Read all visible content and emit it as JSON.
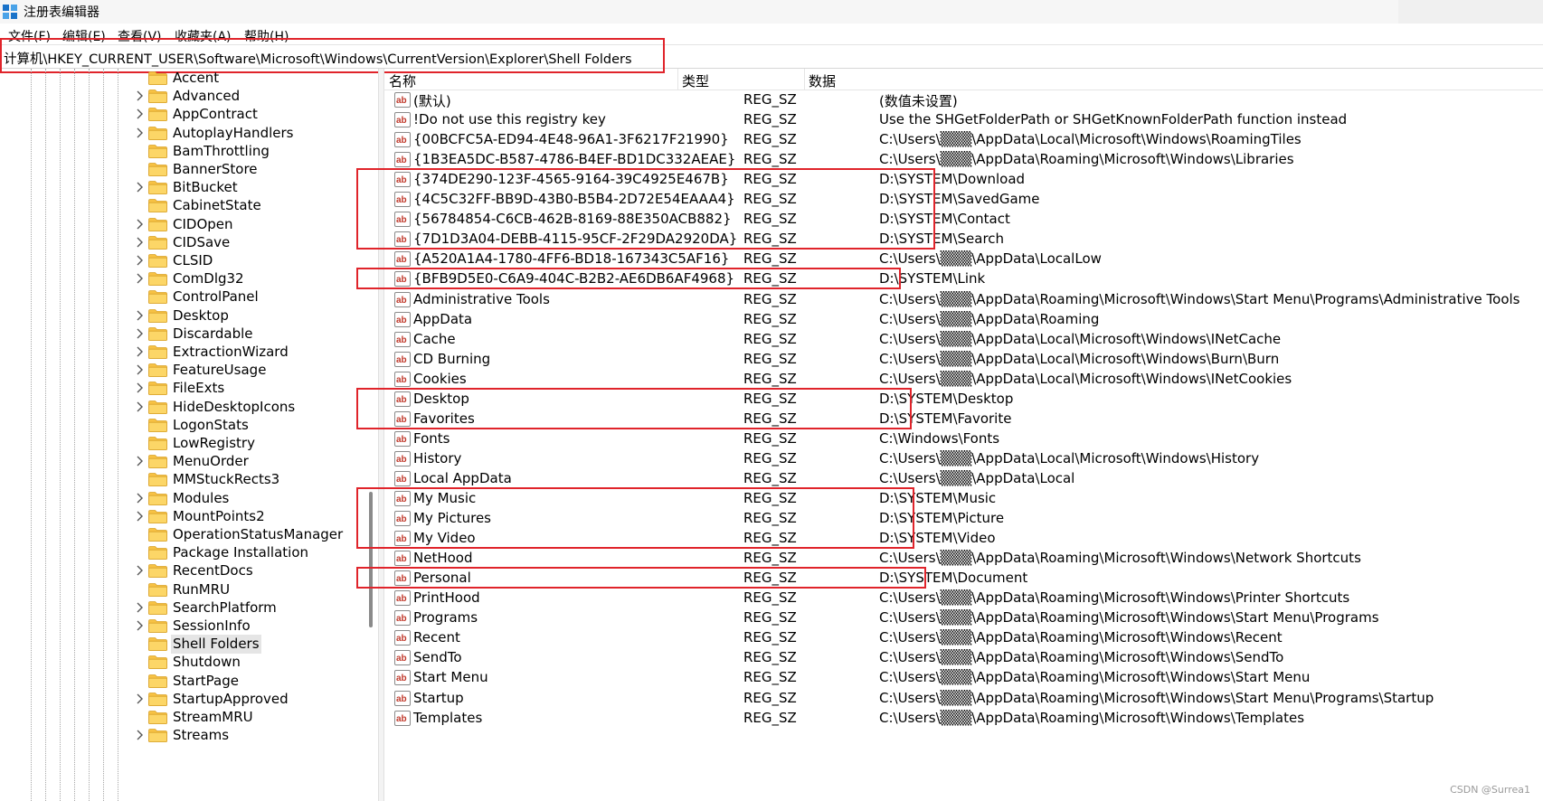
{
  "window": {
    "title": "注册表编辑器",
    "icon": "registry-editor-icon"
  },
  "menu": [
    "文件(F)",
    "编辑(E)",
    "查看(V)",
    "收藏夹(A)",
    "帮助(H)"
  ],
  "address": "计算机\\HKEY_CURRENT_USER\\Software\\Microsoft\\Windows\\CurrentVersion\\Explorer\\Shell Folders",
  "tree": {
    "items": [
      "Accent",
      "Advanced",
      "AppContract",
      "AutoplayHandlers",
      "BamThrottling",
      "BannerStore",
      "BitBucket",
      "CabinetState",
      "CIDOpen",
      "CIDSave",
      "CLSID",
      "ComDlg32",
      "ControlPanel",
      "Desktop",
      "Discardable",
      "ExtractionWizard",
      "FeatureUsage",
      "FileExts",
      "HideDesktopIcons",
      "LogonStats",
      "LowRegistry",
      "MenuOrder",
      "MMStuckRects3",
      "Modules",
      "MountPoints2",
      "OperationStatusManager",
      "Package Installation",
      "RecentDocs",
      "RunMRU",
      "SearchPlatform",
      "SessionInfo",
      "Shell Folders",
      "Shutdown",
      "StartPage",
      "StartupApproved",
      "StreamMRU",
      "Streams"
    ],
    "expandable": [
      false,
      true,
      true,
      true,
      false,
      false,
      true,
      false,
      true,
      true,
      true,
      true,
      false,
      true,
      true,
      true,
      true,
      true,
      true,
      false,
      false,
      true,
      false,
      true,
      true,
      false,
      false,
      true,
      false,
      true,
      true,
      false,
      false,
      false,
      true,
      false,
      true
    ],
    "selected": "Shell Folders"
  },
  "columns": {
    "name": "名称",
    "type": "类型",
    "data": "数据"
  },
  "values": [
    {
      "name": "(默认)",
      "type": "REG_SZ",
      "data": "(数值未设置)"
    },
    {
      "name": "!Do not use this registry key",
      "type": "REG_SZ",
      "data": "Use the SHGetFolderPath or SHGetKnownFolderPath function instead"
    },
    {
      "name": "{00BCFC5A-ED94-4E48-96A1-3F6217F21990}",
      "type": "REG_SZ",
      "data": "C:\\Users\\▒▒▒\\AppData\\Local\\Microsoft\\Windows\\RoamingTiles"
    },
    {
      "name": "{1B3EA5DC-B587-4786-B4EF-BD1DC332AEAE}",
      "type": "REG_SZ",
      "data": "C:\\Users\\▒▒▒\\AppData\\Roaming\\Microsoft\\Windows\\Libraries"
    },
    {
      "name": "{374DE290-123F-4565-9164-39C4925E467B}",
      "type": "REG_SZ",
      "data": "D:\\SYSTEM\\Download"
    },
    {
      "name": "{4C5C32FF-BB9D-43B0-B5B4-2D72E54EAAA4}",
      "type": "REG_SZ",
      "data": "D:\\SYSTEM\\SavedGame"
    },
    {
      "name": "{56784854-C6CB-462B-8169-88E350ACB882}",
      "type": "REG_SZ",
      "data": "D:\\SYSTEM\\Contact"
    },
    {
      "name": "{7D1D3A04-DEBB-4115-95CF-2F29DA2920DA}",
      "type": "REG_SZ",
      "data": "D:\\SYSTEM\\Search"
    },
    {
      "name": "{A520A1A4-1780-4FF6-BD18-167343C5AF16}",
      "type": "REG_SZ",
      "data": "C:\\Users\\▒▒▒\\AppData\\LocalLow"
    },
    {
      "name": "{BFB9D5E0-C6A9-404C-B2B2-AE6DB6AF4968}",
      "type": "REG_SZ",
      "data": "D:\\SYSTEM\\Link"
    },
    {
      "name": "Administrative Tools",
      "type": "REG_SZ",
      "data": "C:\\Users\\▒▒▒\\AppData\\Roaming\\Microsoft\\Windows\\Start Menu\\Programs\\Administrative Tools"
    },
    {
      "name": "AppData",
      "type": "REG_SZ",
      "data": "C:\\Users\\▒▒▒\\AppData\\Roaming"
    },
    {
      "name": "Cache",
      "type": "REG_SZ",
      "data": "C:\\Users\\▒▒▒\\AppData\\Local\\Microsoft\\Windows\\INetCache"
    },
    {
      "name": "CD Burning",
      "type": "REG_SZ",
      "data": "C:\\Users\\▒▒▒\\AppData\\Local\\Microsoft\\Windows\\Burn\\Burn"
    },
    {
      "name": "Cookies",
      "type": "REG_SZ",
      "data": "C:\\Users\\▒▒▒\\AppData\\Local\\Microsoft\\Windows\\INetCookies"
    },
    {
      "name": "Desktop",
      "type": "REG_SZ",
      "data": "D:\\SYSTEM\\Desktop"
    },
    {
      "name": "Favorites",
      "type": "REG_SZ",
      "data": "D:\\SYSTEM\\Favorite"
    },
    {
      "name": "Fonts",
      "type": "REG_SZ",
      "data": "C:\\Windows\\Fonts"
    },
    {
      "name": "History",
      "type": "REG_SZ",
      "data": "C:\\Users\\▒▒▒\\AppData\\Local\\Microsoft\\Windows\\History"
    },
    {
      "name": "Local AppData",
      "type": "REG_SZ",
      "data": "C:\\Users\\▒▒▒\\AppData\\Local"
    },
    {
      "name": "My Music",
      "type": "REG_SZ",
      "data": "D:\\SYSTEM\\Music"
    },
    {
      "name": "My Pictures",
      "type": "REG_SZ",
      "data": "D:\\SYSTEM\\Picture"
    },
    {
      "name": "My Video",
      "type": "REG_SZ",
      "data": "D:\\SYSTEM\\Video"
    },
    {
      "name": "NetHood",
      "type": "REG_SZ",
      "data": "C:\\Users\\▒▒▒\\AppData\\Roaming\\Microsoft\\Windows\\Network Shortcuts"
    },
    {
      "name": "Personal",
      "type": "REG_SZ",
      "data": "D:\\SYSTEM\\Document"
    },
    {
      "name": "PrintHood",
      "type": "REG_SZ",
      "data": "C:\\Users\\▒▒▒\\AppData\\Roaming\\Microsoft\\Windows\\Printer Shortcuts"
    },
    {
      "name": "Programs",
      "type": "REG_SZ",
      "data": "C:\\Users\\▒▒▒\\AppData\\Roaming\\Microsoft\\Windows\\Start Menu\\Programs"
    },
    {
      "name": "Recent",
      "type": "REG_SZ",
      "data": "C:\\Users\\▒▒▒\\AppData\\Roaming\\Microsoft\\Windows\\Recent"
    },
    {
      "name": "SendTo",
      "type": "REG_SZ",
      "data": "C:\\Users\\▒▒▒\\AppData\\Roaming\\Microsoft\\Windows\\SendTo"
    },
    {
      "name": "Start Menu",
      "type": "REG_SZ",
      "data": "C:\\Users\\▒▒▒\\AppData\\Roaming\\Microsoft\\Windows\\Start Menu"
    },
    {
      "name": "Startup",
      "type": "REG_SZ",
      "data": "C:\\Users\\▒▒▒\\AppData\\Roaming\\Microsoft\\Windows\\Start Menu\\Programs\\Startup"
    },
    {
      "name": "Templates",
      "type": "REG_SZ",
      "data": "C:\\Users\\▒▒▒\\AppData\\Roaming\\Microsoft\\Windows\\Templates"
    }
  ],
  "highlight_color": "#e0242b",
  "watermark": "CSDN @Surrea1"
}
